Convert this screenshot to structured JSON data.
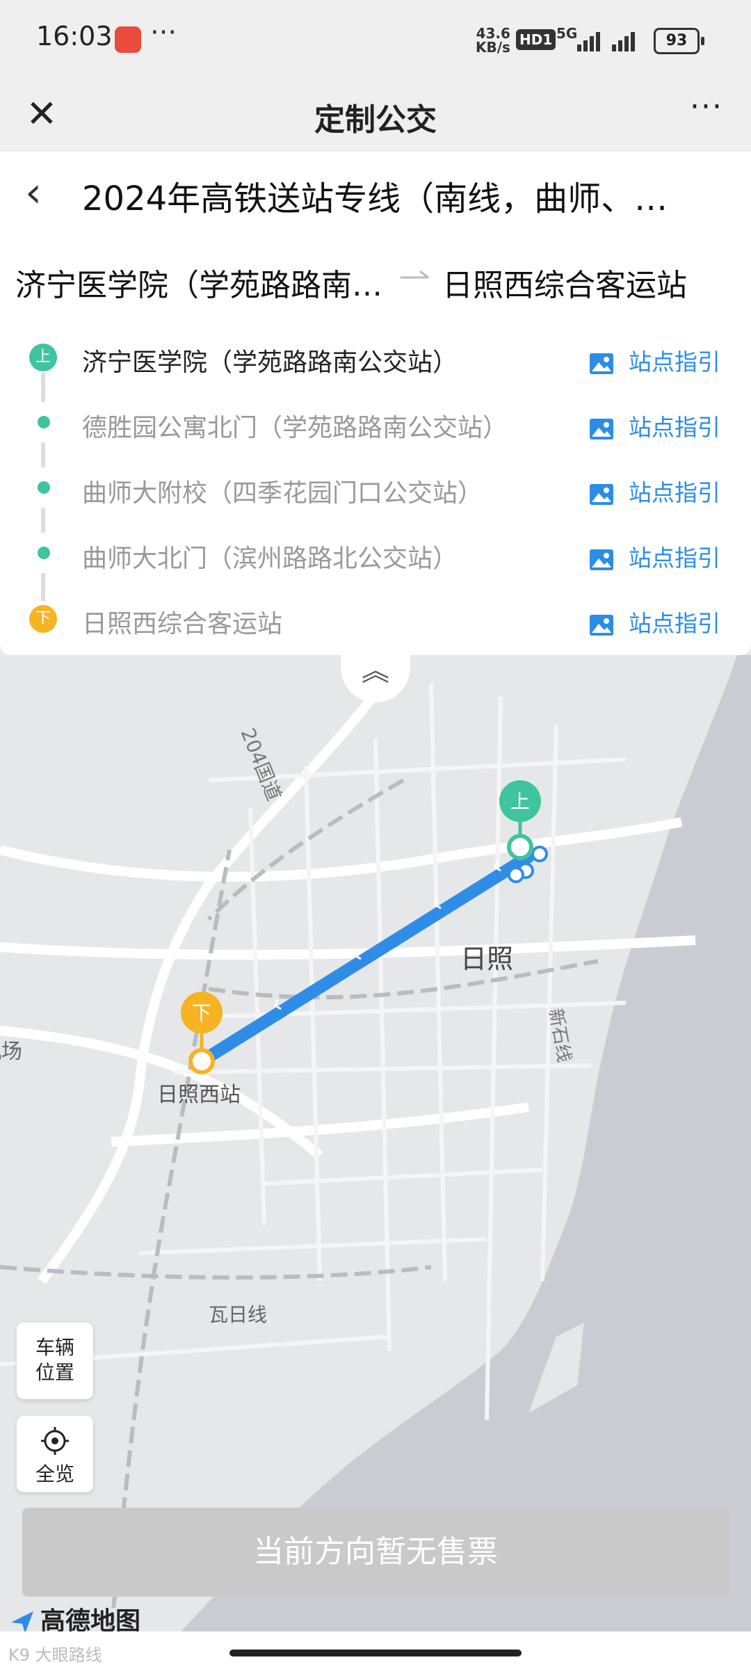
{
  "status_bar": {
    "time": "16:03",
    "more": "···",
    "net_speed_value": "43.6",
    "net_speed_unit": "KB/s",
    "hd_label": "HD1",
    "network": "5G",
    "battery": "93"
  },
  "title_bar": {
    "title": "定制公交",
    "more": "···",
    "close_icon": "close-icon"
  },
  "route": {
    "name": "2024年高铁送站专线（南线，曲师、…",
    "from": "济宁医学院（学苑路路南…",
    "to": "日照西综合客运站"
  },
  "stops": [
    {
      "name": "济宁医学院（学苑路路南公交站）",
      "type": "board",
      "badge": "上",
      "guide": "站点指引"
    },
    {
      "name": "德胜园公寓北门（学苑路路南公交站）",
      "type": "mid",
      "guide": "站点指引"
    },
    {
      "name": "曲师大附校（四季花园门口公交站）",
      "type": "mid",
      "guide": "站点指引"
    },
    {
      "name": "曲师大北门（滨州路路北公交站）",
      "type": "mid",
      "guide": "站点指引"
    },
    {
      "name": "日照西综合客运站",
      "type": "alight",
      "badge": "下",
      "guide": "站点指引"
    }
  ],
  "map": {
    "labels": {
      "highway": "204国道",
      "city": "日照",
      "station": "日照西站",
      "rail_east": "新石线",
      "rail_south": "瓦日线",
      "airport": "机场"
    },
    "board_badge": "上",
    "alight_badge": "下",
    "colors": {
      "route": "#2f8de8",
      "board": "#3fc4a0",
      "alight": "#f6b323",
      "sea": "#c9cdd3"
    }
  },
  "controls": {
    "vehicle_line1": "车辆",
    "vehicle_line2": "位置",
    "overview": "全览"
  },
  "ticket_status": "当前方向暂无售票",
  "logo_text": "高德地图",
  "watermark": "K9 大眼路线"
}
